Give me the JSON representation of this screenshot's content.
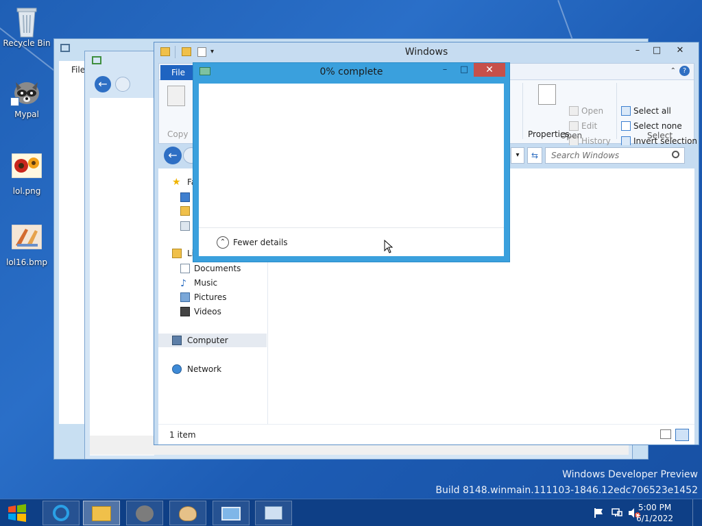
{
  "desktop": {
    "icons": [
      {
        "label": "Recycle Bin"
      },
      {
        "label": "Mypal"
      },
      {
        "label": "lol.png"
      },
      {
        "label": "lol16.bmp"
      }
    ],
    "watermark": {
      "line1": "Windows Developer Preview",
      "line2": "Build 8148.winmain.111103-1846.12edc706523e1452"
    }
  },
  "background_window": {
    "file_tab": "File"
  },
  "explorer": {
    "title": "Windows",
    "ribbon": {
      "file_tab": "File",
      "copy": "Copy",
      "properties": "Properties",
      "open": "Open",
      "edit": "Edit",
      "history": "History",
      "select_all": "Select all",
      "select_none": "Select none",
      "invert_selection": "Invert selection",
      "group_open": "Open",
      "group_select": "Select"
    },
    "search": {
      "placeholder": "Search Windows"
    },
    "nav": {
      "favorites_partial": "Fa",
      "libraries_partial": "Li",
      "documents": "Documents",
      "music": "Music",
      "pictures": "Pictures",
      "videos": "Videos",
      "computer": "Computer",
      "network": "Network"
    },
    "status": {
      "items": "1 item"
    }
  },
  "progress_dialog": {
    "title": "0% complete",
    "percent": 0,
    "fewer_details": "Fewer details"
  },
  "taskbar": {
    "time": "5:00 PM",
    "date": "6/1/2022"
  },
  "colors": {
    "taskbar": "#0e3f86",
    "dialog_frame": "#3aa0dd",
    "close_button": "#c7504a",
    "file_tab": "#1f64c1"
  }
}
